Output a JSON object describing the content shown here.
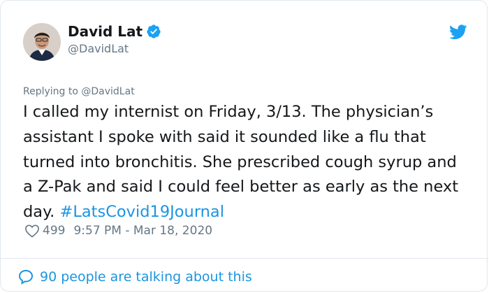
{
  "author": {
    "display_name": "David Lat",
    "handle": "@DavidLat"
  },
  "reply": {
    "prefix": "Replying to ",
    "handle": "@DavidLat"
  },
  "tweet": {
    "text": "I called my internist on Friday, 3/13. The physician’s assistant I spoke with said it sounded like a flu that turned into bronchitis. She prescribed cough syrup and a Z-Pak and said I could feel better as early as the next day. ",
    "hashtag": "#LatsCovid19Journal"
  },
  "meta": {
    "likes": "499",
    "timestamp": "9:57 PM - Mar 18, 2020"
  },
  "footer": {
    "conversation_text": "90 people are talking about this"
  },
  "colors": {
    "link_blue": "#1b95e0",
    "verified_blue": "#1da1f2",
    "secondary_text": "#657786",
    "border": "#e1e8ed"
  },
  "icons": {
    "verified": "verified-badge-icon",
    "logo": "twitter-bird-icon",
    "like": "heart-icon",
    "conversation": "speech-bubble-icon"
  }
}
